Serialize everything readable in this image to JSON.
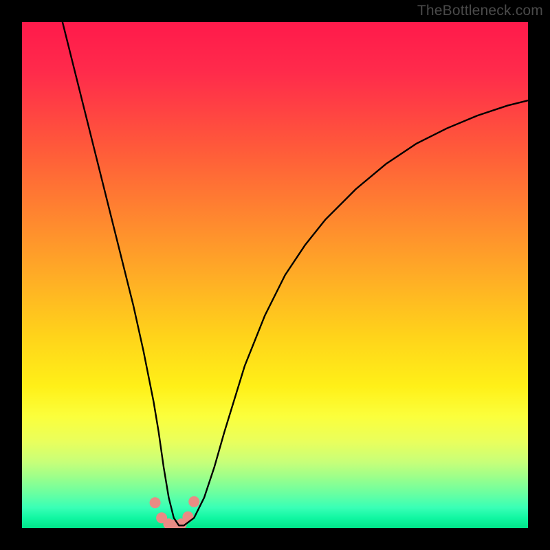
{
  "watermark": "TheBottleneck.com",
  "chart_data": {
    "type": "line",
    "title": "",
    "xlabel": "",
    "ylabel": "",
    "xlim": [
      0,
      100
    ],
    "ylim": [
      0,
      100
    ],
    "grid": false,
    "legend": false,
    "gradient_stops": [
      {
        "pos": 0,
        "color": "#ff1a4b"
      },
      {
        "pos": 25,
        "color": "#ff5a3a"
      },
      {
        "pos": 50,
        "color": "#ffb224"
      },
      {
        "pos": 75,
        "color": "#fff018"
      },
      {
        "pos": 100,
        "color": "#00e489"
      }
    ],
    "series": [
      {
        "name": "bottleneck-curve",
        "color": "#000000",
        "x": [
          8,
          10,
          12,
          14,
          16,
          18,
          20,
          22,
          24,
          26,
          27,
          28,
          29,
          30,
          31,
          32,
          34,
          36,
          38,
          40,
          44,
          48,
          52,
          56,
          60,
          66,
          72,
          78,
          84,
          90,
          96,
          100
        ],
        "y": [
          100,
          92,
          84,
          76,
          68,
          60,
          52,
          44,
          35,
          25,
          19,
          12,
          6,
          2,
          0.5,
          0.5,
          2,
          6,
          12,
          19,
          32,
          42,
          50,
          56,
          61,
          67,
          72,
          76,
          79,
          81.5,
          83.5,
          84.5
        ]
      }
    ],
    "markers": {
      "name": "valley-dots",
      "color": "#e98b84",
      "radius_px": 8,
      "points": [
        {
          "x": 26.3,
          "y": 5.0
        },
        {
          "x": 27.6,
          "y": 2.0
        },
        {
          "x": 29.0,
          "y": 0.8
        },
        {
          "x": 30.2,
          "y": 0.6
        },
        {
          "x": 31.5,
          "y": 0.8
        },
        {
          "x": 32.8,
          "y": 2.2
        },
        {
          "x": 34.0,
          "y": 5.2
        }
      ]
    }
  }
}
